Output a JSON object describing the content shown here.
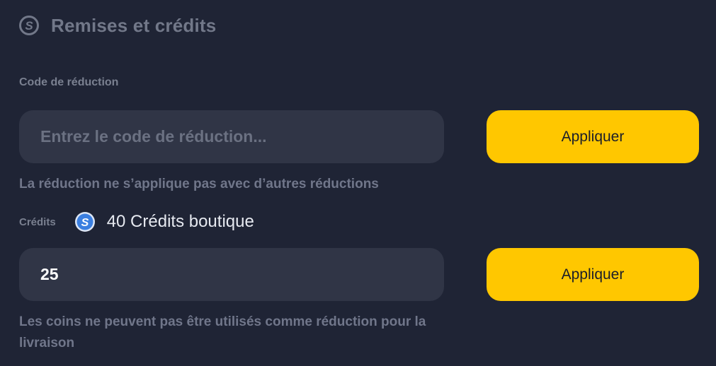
{
  "header": {
    "icon": "coin-s-icon",
    "title": "Remises et crédits"
  },
  "discount": {
    "label": "Code de réduction",
    "placeholder": "Entrez le code de réduction...",
    "value": "",
    "apply_label": "Appliquer",
    "note": "La réduction ne s’applique pas avec d’autres réductions"
  },
  "credits": {
    "label": "Crédits",
    "coin_icon": "shop-credit-coin-icon",
    "balance": "40 Crédits boutique",
    "value": "25",
    "apply_label": "Appliquer",
    "note": "Les coins ne peuvent pas être utilisés comme réduction pour la livraison"
  },
  "colors": {
    "background": "#1f2435",
    "input_background": "#303546",
    "accent": "#ffc700",
    "coin_blue": "#3b7fe0"
  }
}
